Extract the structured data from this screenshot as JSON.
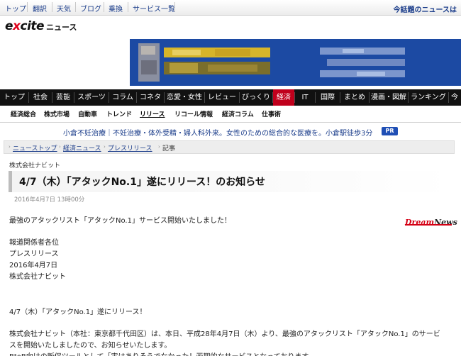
{
  "topbar": {
    "links": [
      "トップ",
      "翻訳",
      "天気",
      "ブログ",
      "乗換",
      "サービス一覧"
    ],
    "notice": "今話題のニュースは"
  },
  "logo": {
    "brand_prefix": "e",
    "brand_x": "x",
    "brand_suffix": "cite",
    "section": "ニュース"
  },
  "nav": {
    "items": [
      "トップ",
      "社会",
      "芸能",
      "スポーツ",
      "コラム",
      "コネタ",
      "恋愛・女性",
      "レビュー",
      "びっくり",
      "経済",
      "IT",
      "国際",
      "まとめ",
      "漫画・図解",
      "ランキング",
      "今"
    ],
    "active": "経済"
  },
  "subnav": {
    "items": [
      "経済総合",
      "株式市場",
      "自動車",
      "トレンド",
      "リリース",
      "リコール情報",
      "経済コラム",
      "仕事術"
    ],
    "active": "リリース"
  },
  "pr": {
    "text": "小倉不妊治療｜不妊治療・体外受精・婦人科外来。女性のための総合的な医療を。小倉駅徒歩3分",
    "badge": "PR"
  },
  "breadcrumb": {
    "items": [
      "ニューストップ",
      "経済ニュース",
      "プレスリリース",
      "記事"
    ]
  },
  "article": {
    "company": "株式会社ナビット",
    "title": "4/7（木）「アタックNo.1」遂にリリース！のお知らせ",
    "date": "2016年4月7日 13時00分",
    "lead": "最強のアタックリスト「アタックNo.1」サービス開始いたしました！",
    "source_logo": {
      "dream": "Dream",
      "news": "News"
    },
    "body": [
      "報道関係者各位",
      "プレスリリース",
      "2016年4月7日",
      "株式会社ナビット",
      "4/7（木）「アタックNo.1」遂にリリース！",
      "株式会社ナビット（本社：東京都千代田区）は、本日、平成28年4月7日（木）より、最強のアタックリスト「アタックNo.1」のサービ",
      "スを開始いたしましたので、お知らせいたします。",
      "BtoB向けの販促ツールとして「実はありそうでなかった！画期的なサービスとなっております。"
    ]
  }
}
